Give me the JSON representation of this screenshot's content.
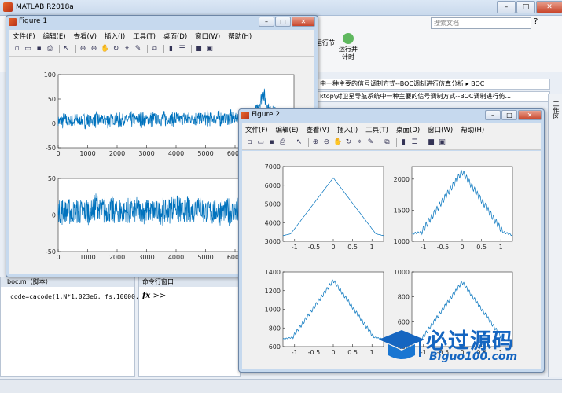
{
  "app": {
    "title": "MATLAB R2018a",
    "search_placeholder": "搜索文档",
    "ribbon_buttons": [
      "运行节",
      "运行并\n计时"
    ],
    "addr_line1": "中一种主要的信号调制方式--BOC调制进行仿真分析 ▸ BOC",
    "addr_line2": "ktop\\对卫星导航系统中一种主要的信号调制方式--BOC调制进行仿...",
    "right_sidebar_label": "工作区",
    "editor_tab": "boc.m（脚本）",
    "editor_code": "code=cacode(1,N*1.023e6, fs,10000,0);",
    "cmd_tab": "命令行窗口",
    "cmd_prompt": ">>",
    "colors": {
      "line": "#0072bd",
      "accent": "#1565c0"
    }
  },
  "figure1": {
    "title": "Figure 1",
    "menus": [
      "文件(F)",
      "编辑(E)",
      "查看(V)",
      "插入(I)",
      "工具(T)",
      "桌面(D)",
      "窗口(W)",
      "帮助(H)"
    ]
  },
  "figure2": {
    "title": "Figure 2",
    "menus": [
      "文件(F)",
      "编辑(E)",
      "查看(V)",
      "插入(I)",
      "工具(T)",
      "桌面(D)",
      "窗口(W)",
      "帮助(H)"
    ]
  },
  "watermark": {
    "text": "必过源码",
    "url": "Biguo100.com"
  },
  "chart_data": [
    {
      "type": "line",
      "figure": "Figure 1",
      "subplot": 1,
      "xlim": [
        0,
        8000
      ],
      "ylim": [
        -50,
        100
      ],
      "xticks": [
        0,
        1000,
        2000,
        3000,
        4000,
        5000,
        6000,
        7000,
        8000
      ],
      "yticks": [
        -50,
        0,
        50,
        100
      ],
      "description_values": {
        "baseline": 5,
        "peak_x": 6950,
        "peak_y": 70
      }
    },
    {
      "type": "line",
      "figure": "Figure 1",
      "subplot": 2,
      "xlim": [
        0,
        8000
      ],
      "ylim": [
        -50,
        50
      ],
      "xticks": [
        0,
        1000,
        2000,
        3000,
        4000,
        5000,
        6000,
        7000,
        8000
      ],
      "yticks": [
        -50,
        0,
        50
      ],
      "description_values": {
        "baseline": 0,
        "peak_x": 6950,
        "peak_y": 40
      }
    },
    {
      "type": "line",
      "figure": "Figure 2",
      "subplot": 1,
      "xlim": [
        -1.3,
        1.3
      ],
      "ylim": [
        3000,
        7000
      ],
      "xticks": [
        -1,
        -0.5,
        0,
        0.5,
        1
      ],
      "yticks": [
        3000,
        4000,
        5000,
        6000,
        7000
      ],
      "x": [
        -1.3,
        -1.1,
        0,
        1.1,
        1.3
      ],
      "y": [
        3300,
        3400,
        6400,
        3400,
        3300
      ]
    },
    {
      "type": "line",
      "figure": "Figure 2",
      "subplot": 2,
      "xlim": [
        -1.3,
        1.3
      ],
      "ylim": [
        1000,
        2200
      ],
      "xticks": [
        -1,
        -0.5,
        0,
        0.5,
        1
      ],
      "yticks": [
        1000,
        1500,
        2000
      ],
      "x": [
        -1.3,
        -1.05,
        0,
        1.05,
        1.3
      ],
      "y": [
        1120,
        1150,
        2120,
        1150,
        1100
      ]
    },
    {
      "type": "line",
      "figure": "Figure 2",
      "subplot": 3,
      "xlim": [
        -1.3,
        1.3
      ],
      "ylim": [
        600,
        1400
      ],
      "xticks": [
        -1,
        -0.5,
        0,
        0.5,
        1
      ],
      "yticks": [
        600,
        800,
        1000,
        1200,
        1400
      ],
      "x": [
        -1.3,
        -1.05,
        0,
        1.05,
        1.3
      ],
      "y": [
        680,
        700,
        1310,
        700,
        680
      ]
    },
    {
      "type": "line",
      "figure": "Figure 2",
      "subplot": 4,
      "xlim": [
        -1.3,
        1.3
      ],
      "ylim": [
        400,
        1000
      ],
      "xticks": [
        -1,
        -0.5,
        0,
        0.5,
        1
      ],
      "yticks": [
        400,
        600,
        800,
        1000
      ],
      "x": [
        -1.3,
        -1.05,
        0,
        1.05,
        1.3
      ],
      "y": [
        440,
        460,
        920,
        460,
        440
      ]
    }
  ]
}
